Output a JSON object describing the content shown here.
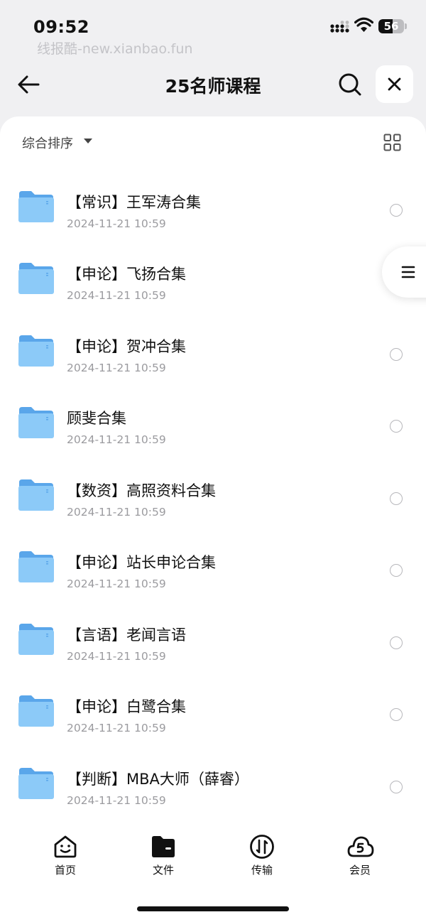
{
  "status_bar": {
    "time": "09:52",
    "watermark": "线报酷-new.xianbao.fun",
    "battery": "56",
    "battery_level": 0.56
  },
  "header": {
    "title": "25名师课程",
    "back_icon": "arrow-left-icon",
    "search_icon": "search-icon",
    "close_icon": "close-icon"
  },
  "toolbar": {
    "sort_label": "综合排序",
    "view_icon": "grid-view-icon"
  },
  "files": [
    {
      "name": "",
      "date": "2024-11-21 10:59"
    },
    {
      "name": "【常识】王军涛合集",
      "date": "2024-11-21 10:59"
    },
    {
      "name": "【申论】飞扬合集",
      "date": "2024-11-21 10:59"
    },
    {
      "name": "【申论】贺冲合集",
      "date": "2024-11-21 10:59"
    },
    {
      "name": "顾斐合集",
      "date": "2024-11-21 10:59"
    },
    {
      "name": "【数资】高照资料合集",
      "date": "2024-11-21 10:59"
    },
    {
      "name": "【申论】站长申论合集",
      "date": "2024-11-21 10:59"
    },
    {
      "name": "【言语】老闻言语",
      "date": "2024-11-21 10:59"
    },
    {
      "name": "【申论】白鹭合集",
      "date": "2024-11-21 10:59"
    },
    {
      "name": "【判断】MBA大师（薛睿）",
      "date": "2024-11-21 10:59"
    }
  ],
  "tabs": [
    {
      "label": "首页",
      "icon": "home-smile-icon"
    },
    {
      "label": "文件",
      "icon": "folder-icon"
    },
    {
      "label": "传输",
      "icon": "transfer-icon"
    },
    {
      "label": "会员",
      "icon": "cloud-vip-icon"
    }
  ],
  "colors": {
    "folder": "#6fb6f2",
    "accent": "#111111",
    "background": "#f0f0f2"
  }
}
